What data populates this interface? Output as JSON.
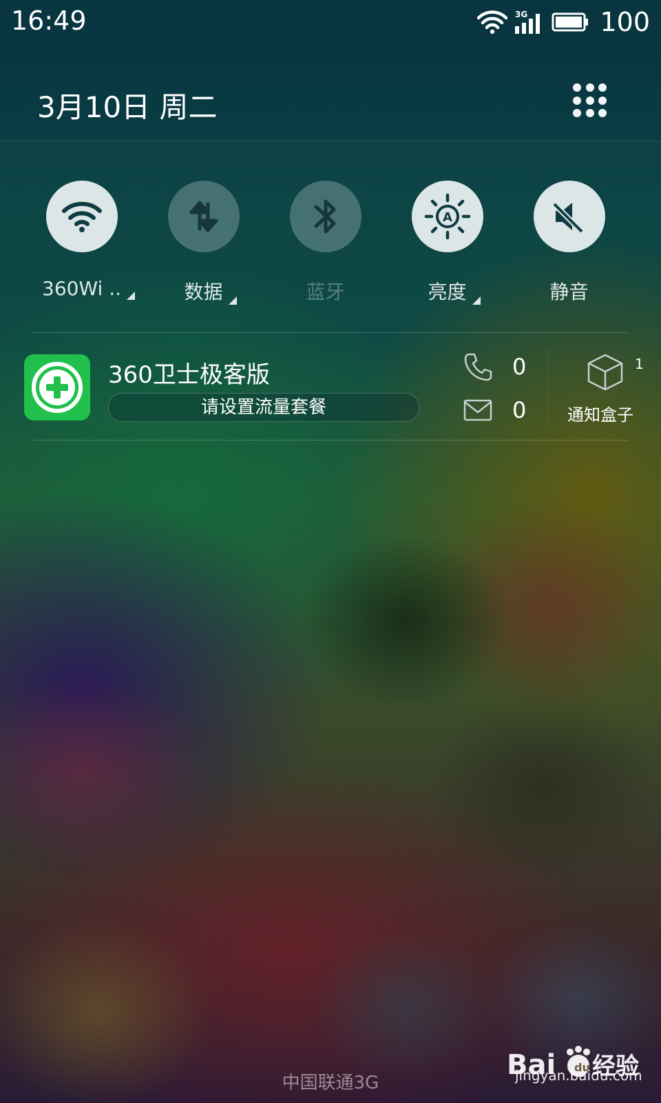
{
  "status_bar": {
    "time": "16:49",
    "network_type": "3G",
    "battery_percent": "100"
  },
  "header": {
    "date": "3月10日  周二"
  },
  "quick_toggles": [
    {
      "label": "360Wi ..",
      "icon": "wifi-icon",
      "state": "on",
      "has_menu": true
    },
    {
      "label": "数据",
      "icon": "data-transfer-icon",
      "state": "off",
      "has_menu": true
    },
    {
      "label": "蓝牙",
      "icon": "bluetooth-icon",
      "state": "off",
      "has_menu": false
    },
    {
      "label": "亮度",
      "icon": "brightness-auto-icon",
      "state": "on",
      "has_menu": true
    },
    {
      "label": "静音",
      "icon": "mute-icon",
      "state": "on",
      "has_menu": false
    }
  ],
  "notification": {
    "app_name": "360卫士极客版",
    "button_label": "请设置流量套餐",
    "missed_calls": "0",
    "unread_messages": "0",
    "box_count": "1",
    "box_label": "通知盒子"
  },
  "footer": {
    "carrier": "中国联通3G",
    "watermark_logo": "Bai经验",
    "watermark_url": "jingyan.baidu.com"
  },
  "colors": {
    "status_bar_bg": "#083540",
    "toggle_on": "#dde6e6",
    "app_icon_green": "#21c04d"
  }
}
